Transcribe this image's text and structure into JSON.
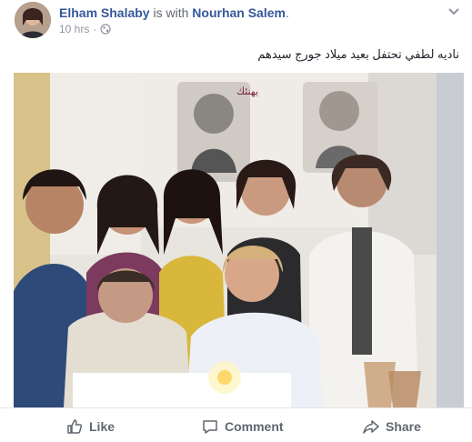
{
  "post": {
    "author": "Elham Shalaby",
    "with_text": " is with ",
    "tagged_user": "Nourhan Salem",
    "period": ".",
    "timestamp": "10 hrs",
    "separator": "·",
    "privacy_icon": "globe-icon",
    "menu_icon": "chevron-down-icon",
    "caption": "ناديه لطفي تحتفل بعيد ميلاد جورج سيدهم"
  },
  "photo": {
    "poster_text": "يهنئك",
    "subject": "group photo of women gathered around a seated elderly man and a woman cutting a birthday cake"
  },
  "actions": {
    "like_label": "Like",
    "comment_label": "Comment",
    "share_label": "Share",
    "like_icon": "thumbs-up-icon",
    "comment_icon": "speech-bubble-icon",
    "share_icon": "share-arrow-icon"
  },
  "colors": {
    "link_blue": "#365899",
    "meta_gray": "#90949c",
    "action_gray": "#606770",
    "divider": "#e5e5e5"
  }
}
